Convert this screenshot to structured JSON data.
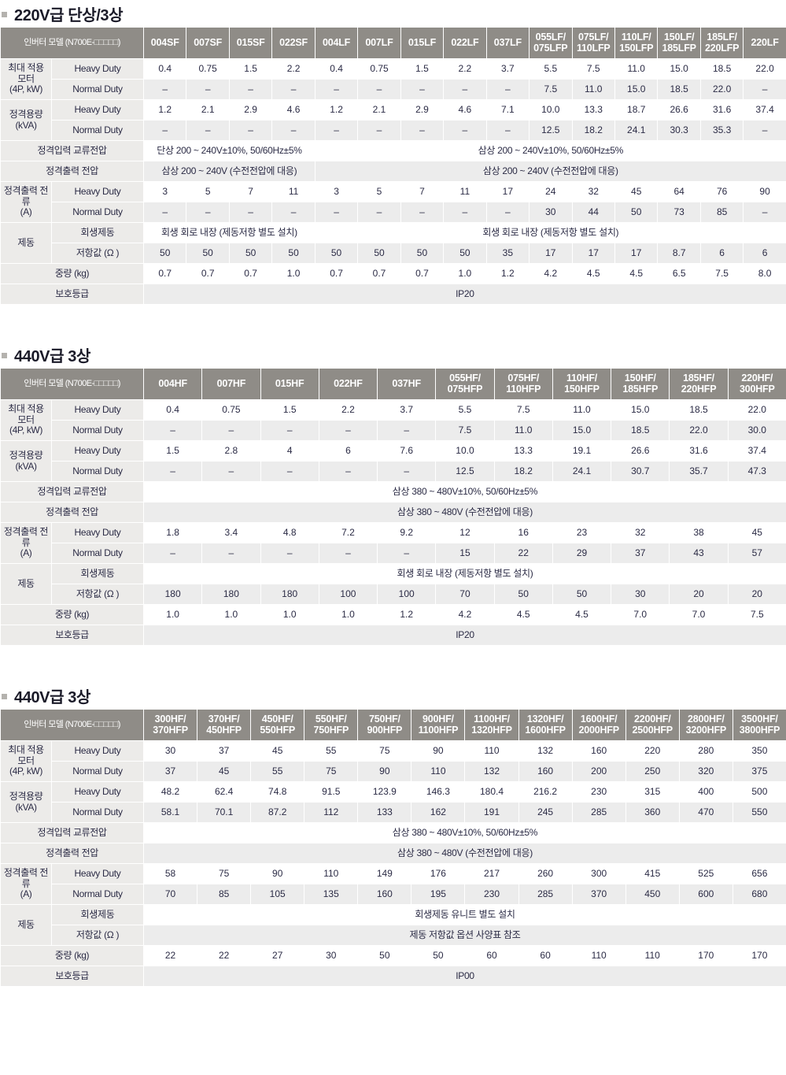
{
  "sections": [
    {
      "heading": "220V급 단상/3상",
      "model_label": "인버터 모델 (N700E-□□□□□)",
      "columns": [
        "004SF",
        "007SF",
        "015SF",
        "022SF",
        "004LF",
        "007LF",
        "015LF",
        "022LF",
        "037LF",
        "055LF/\n075LFP",
        "075LF/\n110LFP",
        "110LF/\n150LFP",
        "150LF/\n185LFP",
        "185LF/\n220LFP",
        "220LF"
      ],
      "columns_display": [
        {
          "l1": "004SF",
          "l2": ""
        },
        {
          "l1": "007SF",
          "l2": ""
        },
        {
          "l1": "015SF",
          "l2": ""
        },
        {
          "l1": "022SF",
          "l2": ""
        },
        {
          "l1": "004LF",
          "l2": ""
        },
        {
          "l1": "007LF",
          "l2": ""
        },
        {
          "l1": "015LF",
          "l2": ""
        },
        {
          "l1": "022LF",
          "l2": ""
        },
        {
          "l1": "037LF",
          "l2": ""
        },
        {
          "l1": "055LF/",
          "l2": "075LFP"
        },
        {
          "l1": "075LF/",
          "l2": "110LFP"
        },
        {
          "l1": "110LF/",
          "l2": "150LFP"
        },
        {
          "l1": "150LF/",
          "l2": "185LFP"
        },
        {
          "l1": "185LF/",
          "l2": "220LFP"
        },
        {
          "l1": "220LF",
          "l2": ""
        }
      ],
      "rows": {
        "motor_label_l1": "최대 적용 모터",
        "motor_label_l2": "(4P, kW)",
        "capacity_label_l1": "정격용량",
        "capacity_label_l2": "(kVA)",
        "current_label_l1": "정격출력 전류",
        "current_label_l2": "(A)",
        "brake_label": "제동",
        "heavy": "Heavy Duty",
        "normal": "Normal Duty",
        "regen": "회생제동",
        "resistance": "저항값 (Ω )",
        "input_voltage_label": "정격입력 교류전압",
        "output_voltage_label": "정격출력 전압",
        "weight_label": "중량 (kg)",
        "protection_label": "보호등급"
      },
      "motor_heavy": [
        "0.4",
        "0.75",
        "1.5",
        "2.2",
        "0.4",
        "0.75",
        "1.5",
        "2.2",
        "3.7",
        "5.5",
        "7.5",
        "11.0",
        "15.0",
        "18.5",
        "22.0"
      ],
      "motor_normal": [
        "–",
        "–",
        "–",
        "–",
        "–",
        "–",
        "–",
        "–",
        "–",
        "7.5",
        "11.0",
        "15.0",
        "18.5",
        "22.0",
        "–"
      ],
      "capacity_heavy": [
        "1.2",
        "2.1",
        "2.9",
        "4.6",
        "1.2",
        "2.1",
        "2.9",
        "4.6",
        "7.1",
        "10.0",
        "13.3",
        "18.7",
        "26.6",
        "31.6",
        "37.4"
      ],
      "capacity_normal": [
        "–",
        "–",
        "–",
        "–",
        "–",
        "–",
        "–",
        "–",
        "–",
        "12.5",
        "18.2",
        "24.1",
        "30.3",
        "35.3",
        "–"
      ],
      "input_voltage": [
        {
          "text": "단상 200 ~ 240V±10%, 50/60Hz±5%",
          "span": 4
        },
        {
          "text": "삼상 200 ~ 240V±10%, 50/60Hz±5%",
          "span": 11
        }
      ],
      "output_voltage": [
        {
          "text": "삼상 200 ~ 240V (수전전압에 대응)",
          "span": 4
        },
        {
          "text": "삼상 200 ~ 240V (수전전압에 대응)",
          "span": 11
        }
      ],
      "current_heavy": [
        "3",
        "5",
        "7",
        "11",
        "3",
        "5",
        "7",
        "11",
        "17",
        "24",
        "32",
        "45",
        "64",
        "76",
        "90"
      ],
      "current_normal": [
        "–",
        "–",
        "–",
        "–",
        "–",
        "–",
        "–",
        "–",
        "–",
        "30",
        "44",
        "50",
        "73",
        "85",
        "–"
      ],
      "regen_cells": [
        {
          "text": "회생 회로 내장 (제동저항 별도 설치)",
          "span": 4
        },
        {
          "text": "회생 회로 내장 (제동저항 별도 설치)",
          "span": 11
        }
      ],
      "resistance": [
        "50",
        "50",
        "50",
        "50",
        "50",
        "50",
        "50",
        "50",
        "35",
        "17",
        "17",
        "17",
        "8.7",
        "6",
        "6"
      ],
      "weight": [
        "0.7",
        "0.7",
        "0.7",
        "1.0",
        "0.7",
        "0.7",
        "0.7",
        "1.0",
        "1.2",
        "4.2",
        "4.5",
        "4.5",
        "6.5",
        "7.5",
        "8.0"
      ],
      "protection": "IP20"
    },
    {
      "heading": "440V급 3상",
      "model_label": "인버터 모델 (N700E-□□□□□)",
      "columns_display": [
        {
          "l1": "004HF",
          "l2": ""
        },
        {
          "l1": "007HF",
          "l2": ""
        },
        {
          "l1": "015HF",
          "l2": ""
        },
        {
          "l1": "022HF",
          "l2": ""
        },
        {
          "l1": "037HF",
          "l2": ""
        },
        {
          "l1": "055HF/",
          "l2": "075HFP"
        },
        {
          "l1": "075HF/",
          "l2": "110HFP"
        },
        {
          "l1": "110HF/",
          "l2": "150HFP"
        },
        {
          "l1": "150HF/",
          "l2": "185HFP"
        },
        {
          "l1": "185HF/",
          "l2": "220HFP"
        },
        {
          "l1": "220HF/",
          "l2": "300HFP"
        }
      ],
      "rows": {
        "motor_label_l1": "최대 적용 모터",
        "motor_label_l2": "(4P, kW)",
        "capacity_label_l1": "정격용량",
        "capacity_label_l2": "(kVA)",
        "current_label_l1": "정격출력 전류",
        "current_label_l2": "(A)",
        "brake_label": "제동",
        "heavy": "Heavy Duty",
        "normal": "Normal Duty",
        "regen": "회생제동",
        "resistance": "저항값 (Ω )",
        "input_voltage_label": "정격입력 교류전압",
        "output_voltage_label": "정격출력 전압",
        "weight_label": "중량 (kg)",
        "protection_label": "보호등급"
      },
      "motor_heavy": [
        "0.4",
        "0.75",
        "1.5",
        "2.2",
        "3.7",
        "5.5",
        "7.5",
        "11.0",
        "15.0",
        "18.5",
        "22.0"
      ],
      "motor_normal": [
        "–",
        "–",
        "–",
        "–",
        "–",
        "7.5",
        "11.0",
        "15.0",
        "18.5",
        "22.0",
        "30.0"
      ],
      "capacity_heavy": [
        "1.5",
        "2.8",
        "4",
        "6",
        "7.6",
        "10.0",
        "13.3",
        "19.1",
        "26.6",
        "31.6",
        "37.4"
      ],
      "capacity_normal": [
        "–",
        "–",
        "–",
        "–",
        "–",
        "12.5",
        "18.2",
        "24.1",
        "30.7",
        "35.7",
        "47.3"
      ],
      "input_voltage": [
        {
          "text": "삼상 380 ~ 480V±10%, 50/60Hz±5%",
          "span": 11
        }
      ],
      "output_voltage": [
        {
          "text": "삼상 380 ~ 480V (수전전압에 대응)",
          "span": 11
        }
      ],
      "current_heavy": [
        "1.8",
        "3.4",
        "4.8",
        "7.2",
        "9.2",
        "12",
        "16",
        "23",
        "32",
        "38",
        "45"
      ],
      "current_normal": [
        "–",
        "–",
        "–",
        "–",
        "–",
        "15",
        "22",
        "29",
        "37",
        "43",
        "57"
      ],
      "regen_cells": [
        {
          "text": "회생 회로 내장 (제동저항 별도 설치)",
          "span": 11
        }
      ],
      "resistance": [
        "180",
        "180",
        "180",
        "100",
        "100",
        "70",
        "50",
        "50",
        "30",
        "20",
        "20"
      ],
      "weight": [
        "1.0",
        "1.0",
        "1.0",
        "1.0",
        "1.2",
        "4.2",
        "4.5",
        "4.5",
        "7.0",
        "7.0",
        "7.5"
      ],
      "protection": "IP20"
    },
    {
      "heading": "440V급 3상",
      "model_label": "인버터 모델 (N700E-□□□□□)",
      "columns_display": [
        {
          "l1": "300HF/",
          "l2": "370HFP"
        },
        {
          "l1": "370HF/",
          "l2": "450HFP"
        },
        {
          "l1": "450HF/",
          "l2": "550HFP"
        },
        {
          "l1": "550HF/",
          "l2": "750HFP"
        },
        {
          "l1": "750HF/",
          "l2": "900HFP"
        },
        {
          "l1": "900HF/",
          "l2": "1100HFP"
        },
        {
          "l1": "1100HF/",
          "l2": "1320HFP"
        },
        {
          "l1": "1320HF/",
          "l2": "1600HFP"
        },
        {
          "l1": "1600HF/",
          "l2": "2000HFP"
        },
        {
          "l1": "2200HF/",
          "l2": "2500HFP"
        },
        {
          "l1": "2800HF/",
          "l2": "3200HFP"
        },
        {
          "l1": "3500HF/",
          "l2": "3800HFP"
        }
      ],
      "rows": {
        "motor_label_l1": "최대 적용 모터",
        "motor_label_l2": "(4P, kW)",
        "capacity_label_l1": "정격용량",
        "capacity_label_l2": "(kVA)",
        "current_label_l1": "정격출력 전류",
        "current_label_l2": "(A)",
        "brake_label": "제동",
        "heavy": "Heavy Duty",
        "normal": "Normal Duty",
        "regen": "회생제동",
        "resistance": "저항값 (Ω )",
        "input_voltage_label": "정격입력 교류전압",
        "output_voltage_label": "정격출력 전압",
        "weight_label": "중량 (kg)",
        "protection_label": "보호등급"
      },
      "motor_heavy": [
        "30",
        "37",
        "45",
        "55",
        "75",
        "90",
        "110",
        "132",
        "160",
        "220",
        "280",
        "350"
      ],
      "motor_normal": [
        "37",
        "45",
        "55",
        "75",
        "90",
        "110",
        "132",
        "160",
        "200",
        "250",
        "320",
        "375"
      ],
      "capacity_heavy": [
        "48.2",
        "62.4",
        "74.8",
        "91.5",
        "123.9",
        "146.3",
        "180.4",
        "216.2",
        "230",
        "315",
        "400",
        "500"
      ],
      "capacity_normal": [
        "58.1",
        "70.1",
        "87.2",
        "112",
        "133",
        "162",
        "191",
        "245",
        "285",
        "360",
        "470",
        "550"
      ],
      "input_voltage": [
        {
          "text": "삼상 380 ~ 480V±10%, 50/60Hz±5%",
          "span": 12
        }
      ],
      "output_voltage": [
        {
          "text": "삼상 380 ~ 480V (수전전압에 대응)",
          "span": 12
        }
      ],
      "current_heavy": [
        "58",
        "75",
        "90",
        "110",
        "149",
        "176",
        "217",
        "260",
        "300",
        "415",
        "525",
        "656"
      ],
      "current_normal": [
        "70",
        "85",
        "105",
        "135",
        "160",
        "195",
        "230",
        "285",
        "370",
        "450",
        "600",
        "680"
      ],
      "regen_cells": [
        {
          "text": "회생제동 유니트 별도 설치",
          "span": 12
        }
      ],
      "resistance_cells": [
        {
          "text": "제동 저항값 옵션 사양표 참조",
          "span": 12
        }
      ],
      "weight": [
        "22",
        "22",
        "27",
        "30",
        "50",
        "50",
        "60",
        "60",
        "110",
        "110",
        "170",
        "170"
      ],
      "protection": "IP00"
    }
  ]
}
